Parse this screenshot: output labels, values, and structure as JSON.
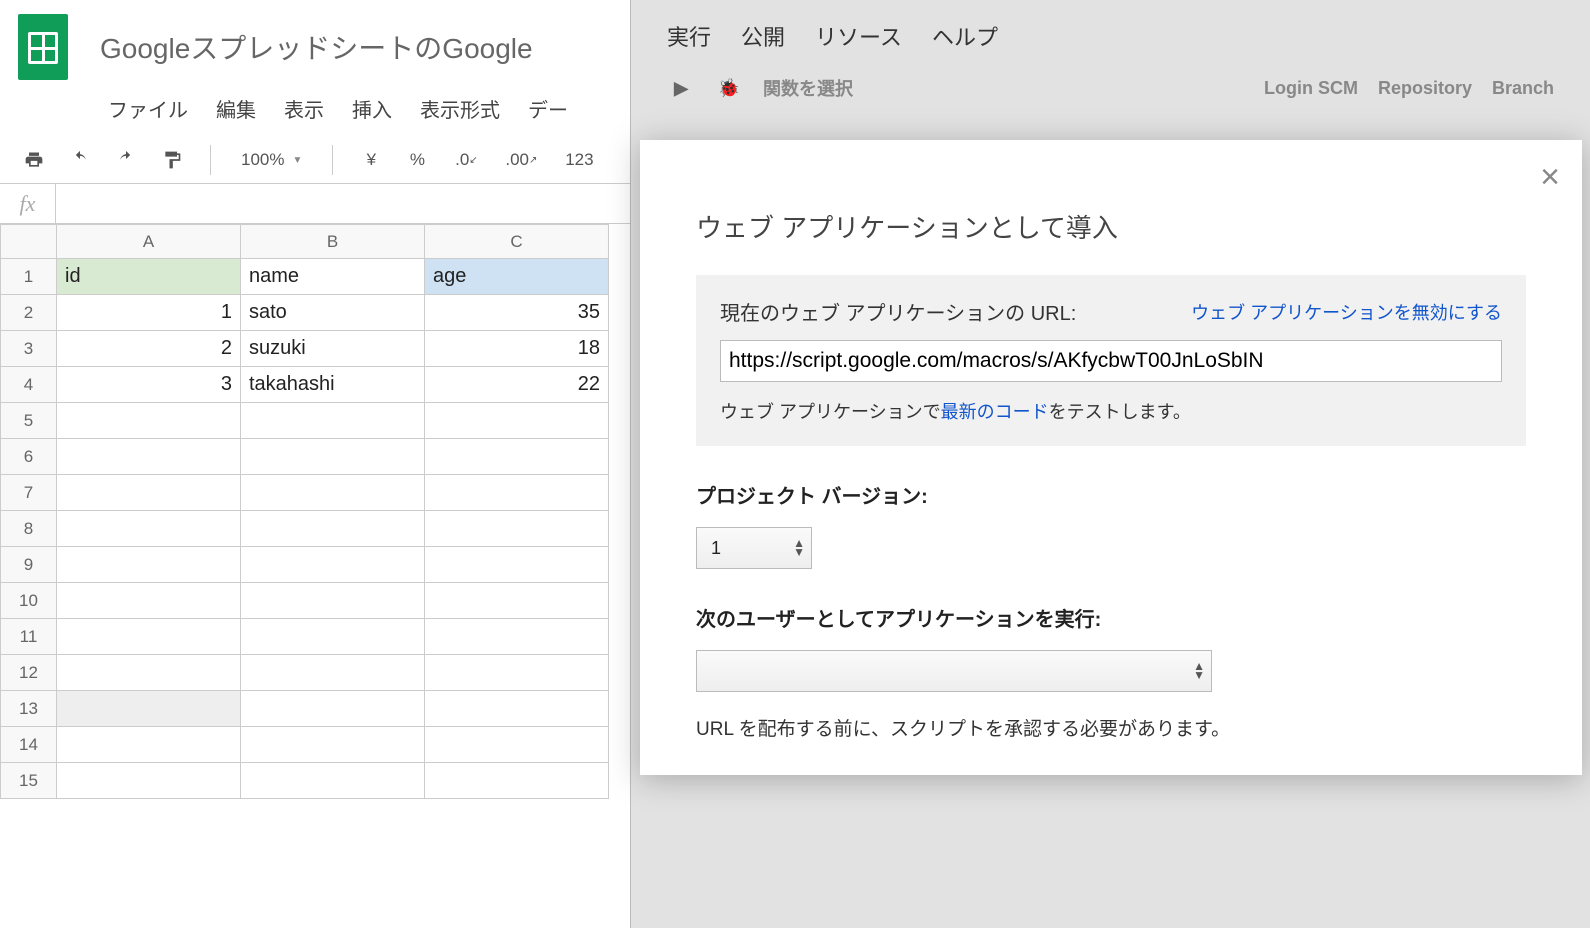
{
  "spreadsheet": {
    "title": "GoogleスプレッドシートのGoogle",
    "menus": [
      "ファイル",
      "編集",
      "表示",
      "挿入",
      "表示形式",
      "デー"
    ],
    "toolbar": {
      "zoom": "100%",
      "currency": "¥",
      "percent": "%",
      "dec_dec": ".0",
      "dec_inc": ".00",
      "numfmt": "123"
    },
    "fx_label": "fx",
    "columns": [
      "A",
      "B",
      "C"
    ],
    "rows": [
      {
        "n": 1,
        "kind": "header",
        "id": "id",
        "name": "name",
        "age": "age"
      },
      {
        "n": 2,
        "kind": "data",
        "id": 1,
        "name": "sato",
        "age": 35
      },
      {
        "n": 3,
        "kind": "data",
        "id": 2,
        "name": "suzuki",
        "age": 18
      },
      {
        "n": 4,
        "kind": "data",
        "id": 3,
        "name": "takahashi",
        "age": 22
      },
      {
        "n": 5
      },
      {
        "n": 6
      },
      {
        "n": 7
      },
      {
        "n": 8
      },
      {
        "n": 9
      },
      {
        "n": 10
      },
      {
        "n": 11
      },
      {
        "n": 12
      },
      {
        "n": 13
      },
      {
        "n": 14
      },
      {
        "n": 15
      }
    ]
  },
  "script_editor": {
    "menus": [
      "実行",
      "公開",
      "リソース",
      "ヘルプ"
    ],
    "tb_select_fn": "関数を選択",
    "tabs": [
      "Login SCM",
      "Repository",
      "Branch"
    ]
  },
  "dialog": {
    "title": "ウェブ アプリケーションとして導入",
    "url_label": "現在のウェブ アプリケーションの URL:",
    "disable_link": "ウェブ アプリケーションを無効にする",
    "url_value": "https://script.google.com/macros/s/AKfycbwT00JnLoSbIN",
    "test_prefix": "ウェブ アプリケーションで",
    "test_link": "最新のコード",
    "test_suffix": "をテストします。",
    "version_label": "プロジェクト バージョン:",
    "version_value": "1",
    "runas_label": "次のユーザーとしてアプリケーションを実行:",
    "runas_value": "",
    "note": "URL を配布する前に、スクリプトを承認する必要があります。",
    "close": "×"
  }
}
